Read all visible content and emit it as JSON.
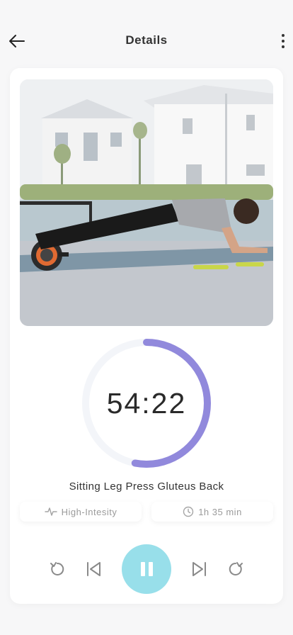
{
  "header": {
    "title": "Details"
  },
  "timer": {
    "display": "54:22",
    "progress_fraction": 0.53,
    "accent_color": "#9189dc",
    "track_color": "#f3f5f9"
  },
  "exercise": {
    "name": "Sitting Leg Press Gluteus Back"
  },
  "stats": {
    "intensity": "High-Intesity",
    "duration": "1h 35 min"
  },
  "icons": {
    "back": "arrow-left-icon",
    "more": "more-vertical-icon",
    "intensity": "pulse-icon",
    "duration": "clock-icon",
    "rewind": "rotate-left-icon",
    "previous": "skip-previous-icon",
    "pause": "pause-icon",
    "next": "skip-next-icon",
    "forward": "rotate-right-icon"
  },
  "colors": {
    "play_button": "#98dfea",
    "background": "#f7f7f8"
  }
}
